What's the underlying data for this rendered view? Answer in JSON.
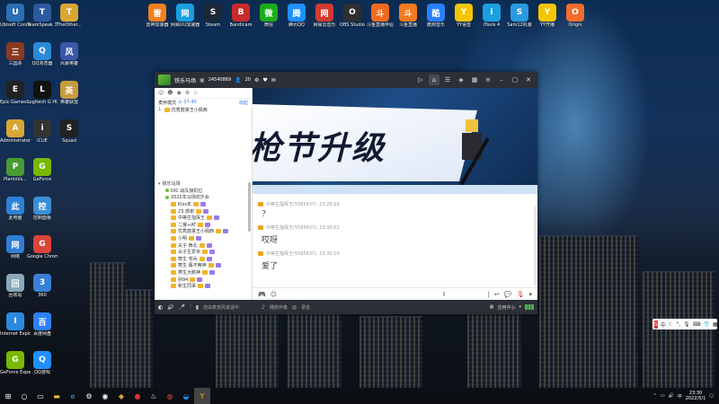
{
  "desktop_icons_col1": [
    {
      "label": "Ubisoft Connect",
      "icon": "ubisoft-icon",
      "color": "#2a6fb6"
    },
    {
      "label": "三国杀",
      "icon": "game-icon",
      "color": "#8a3a1e"
    },
    {
      "label": "Epic Games Launcher",
      "icon": "epic-icon",
      "color": "#222"
    },
    {
      "label": "Administrator",
      "icon": "user-folder-icon",
      "color": "#d8a634"
    },
    {
      "label": "PlantsVs...",
      "icon": "plants-icon",
      "color": "#4a9a34"
    },
    {
      "label": "此电脑",
      "icon": "computer-icon",
      "color": "#2e7fd6"
    },
    {
      "label": "网络",
      "icon": "network-icon",
      "color": "#2e7fd6"
    },
    {
      "label": "回收站",
      "icon": "recycle-icon",
      "color": "#8ab"
    },
    {
      "label": "Internet Explorer",
      "icon": "ie-icon",
      "color": "#2b8ae0"
    },
    {
      "label": "GeForce Experience",
      "icon": "geforce-icon",
      "color": "#76b900"
    }
  ],
  "desktop_icons_col2": [
    {
      "label": "TeamSpeak 3",
      "icon": "teamspeak-icon",
      "color": "#2c5aa0"
    },
    {
      "label": "QQ浏览器",
      "icon": "qqbrowser-icon",
      "color": "#2a8ad6"
    },
    {
      "label": "Logitech G HUB",
      "icon": "logitech-icon",
      "color": "#111"
    },
    {
      "label": "iCUE",
      "icon": "icue-icon",
      "color": "#333"
    },
    {
      "label": "GeForce",
      "icon": "geforce-icon",
      "color": "#76b900"
    },
    {
      "label": "控制面板",
      "icon": "control-panel-icon",
      "color": "#3b8fd6"
    },
    {
      "label": "Google Chrome",
      "icon": "chrome-icon",
      "color": "#db4437"
    },
    {
      "label": "360",
      "icon": "folder-icon",
      "color": "#3a7fd6"
    },
    {
      "label": "百度网盘",
      "icon": "baidu-icon",
      "color": "#2e7fff"
    },
    {
      "label": "QQ游戏",
      "icon": "qqgame-icon",
      "color": "#1e90ff"
    }
  ],
  "desktop_icons_col3": [
    {
      "label": "TheOther...",
      "icon": "folder-icon",
      "color": "#d8a634"
    },
    {
      "label": "风暴英雄",
      "icon": "game-icon",
      "color": "#3a58a8"
    },
    {
      "label": "英雄联盟",
      "icon": "lol-icon",
      "color": "#c89b3c"
    },
    {
      "label": "Squad",
      "icon": "squad-icon",
      "color": "#222"
    }
  ],
  "top_icons": [
    {
      "label": "雷神加速器",
      "icon": "leishen-icon",
      "color": "#f08020"
    },
    {
      "label": "网易UU加速器",
      "icon": "uu-icon",
      "color": "#1aa0e0"
    },
    {
      "label": "Steam",
      "icon": "steam-icon",
      "color": "#1b2838"
    },
    {
      "label": "Bandicam",
      "icon": "bandicam-icon",
      "color": "#c92a2a"
    },
    {
      "label": "微信",
      "icon": "wechat-icon",
      "color": "#1aad19"
    },
    {
      "label": "腾讯QQ",
      "icon": "qq-icon",
      "color": "#1e90ff"
    },
    {
      "label": "网易云音乐",
      "icon": "netease-icon",
      "color": "#d33a31"
    },
    {
      "label": "OBS Studio",
      "icon": "obs-icon",
      "color": "#302e31"
    },
    {
      "label": "斗鱼直播伴侣",
      "icon": "douyu-icon",
      "color": "#f06a20"
    },
    {
      "label": "斗鱼直播",
      "icon": "douyu-icon",
      "color": "#f47a20"
    },
    {
      "label": "酷狗音乐",
      "icon": "kugou-icon",
      "color": "#2a7fff"
    },
    {
      "label": "YY语音",
      "icon": "yy-icon",
      "color": "#f5c500"
    },
    {
      "label": "iTools 4",
      "icon": "itools-icon",
      "color": "#1aa0e0"
    },
    {
      "label": "Sam12机装",
      "icon": "sam-icon",
      "color": "#2a9ae0"
    },
    {
      "label": "YY开播",
      "icon": "yy-icon",
      "color": "#f5c500"
    },
    {
      "label": "Origin",
      "icon": "origin-icon",
      "color": "#f56c2d"
    }
  ],
  "app": {
    "channel_name": "铁乐马场",
    "channel_id": "24540869",
    "user_count": "20",
    "left_top": {
      "mode_label": "麦序模式",
      "timer": "07:40",
      "link": "收起"
    },
    "queue": [
      {
        "index": "1.",
        "name": "优秀鼓掌王小佩西"
      }
    ],
    "tree_root": "铁乐马场",
    "channels": [
      {
        "name": "DIC 战队接机位",
        "indent": 1
      },
      {
        "name": "2022年马场欢乐会",
        "indent": 1
      },
      {
        "name": "Kiss年",
        "indent": 2
      },
      {
        "name": "23 感谢",
        "indent": 2
      },
      {
        "name": "中等生指挥王",
        "indent": 2
      },
      {
        "name": "二猴+AT",
        "indent": 2
      },
      {
        "name": "优秀鼓掌王小佩西",
        "indent": 2
      },
      {
        "name": "小明",
        "indent": 2
      },
      {
        "name": "尖子 西北",
        "indent": 2
      },
      {
        "name": "尖子生爱米",
        "indent": 2
      },
      {
        "name": "寒生 宅兵",
        "indent": 2
      },
      {
        "name": "寒生 幕不两神",
        "indent": 2
      },
      {
        "name": "寒生大鹅神",
        "indent": 2
      },
      {
        "name": "别94",
        "indent": 2
      },
      {
        "name": "新生同事",
        "indent": 2
      }
    ],
    "banner_title": "枪节升级",
    "messages": [
      {
        "user": "中等生指挥王(5565437)",
        "time": "23:29:26",
        "text": "?"
      },
      {
        "user": "中等生指挥王(5565437)",
        "time": "23:30:02",
        "text": "哎呀"
      },
      {
        "user": "中等生指挥王(5565437)",
        "time": "23:30:10",
        "text": "爱了"
      }
    ],
    "bottom": {
      "placeholder": "自由麦克风说话中",
      "broadcast": "播放伴奏",
      "record": "录音",
      "app_label": "应用中心"
    }
  },
  "ime": {
    "label": "中"
  },
  "clock": {
    "time": "23:30",
    "date": "2022/5/1"
  }
}
